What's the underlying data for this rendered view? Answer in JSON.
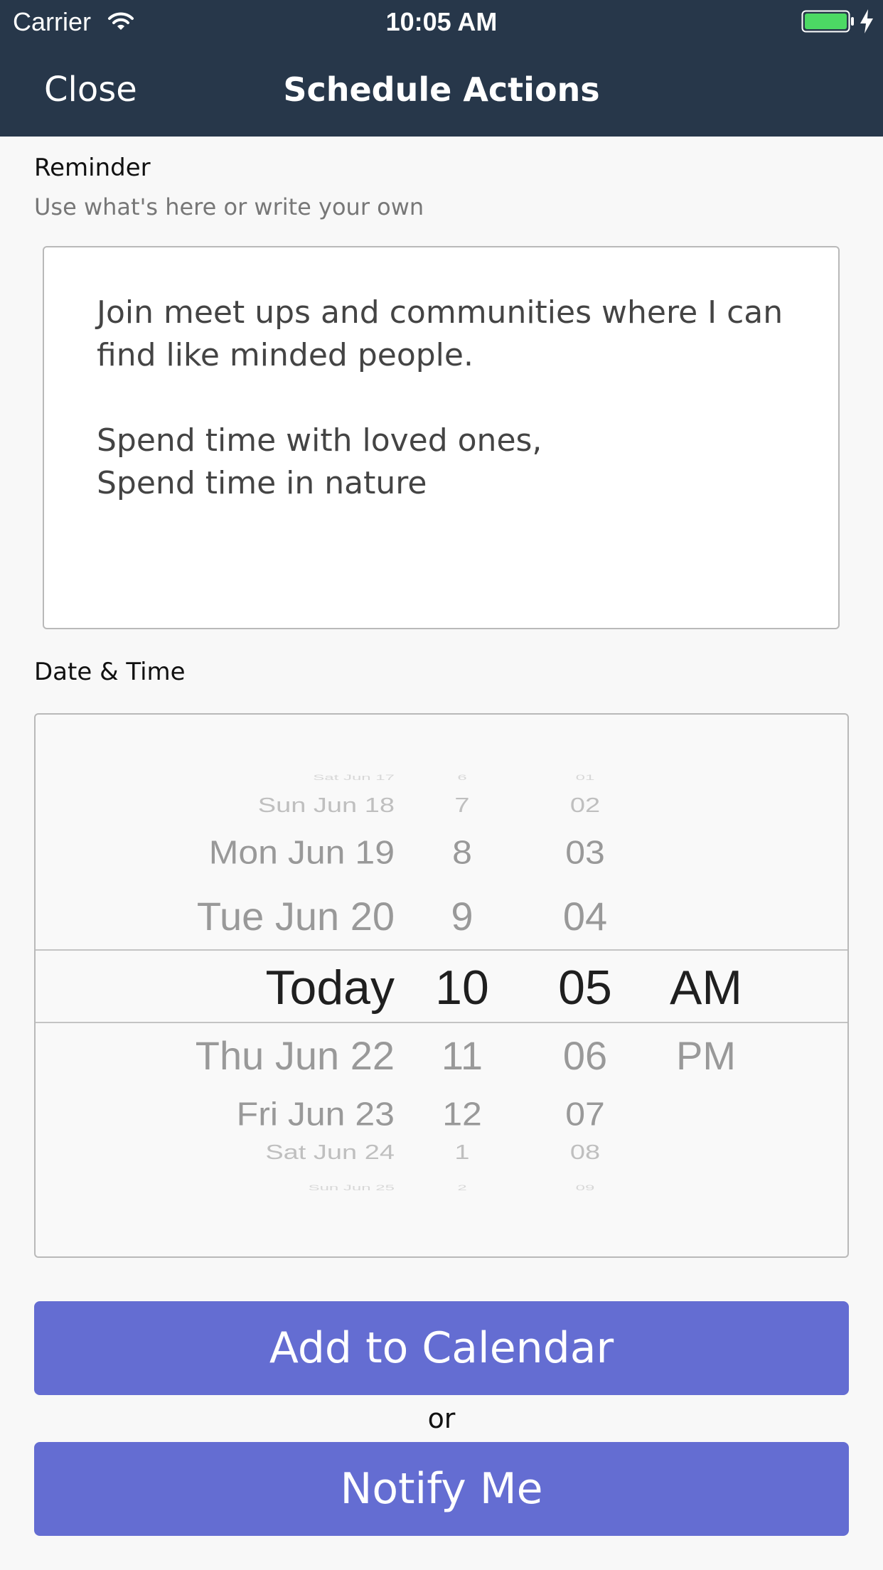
{
  "status_bar": {
    "carrier": "Carrier",
    "time": "10:05 AM",
    "battery_color": "#4cd964"
  },
  "nav": {
    "close_label": "Close",
    "title": "Schedule Actions",
    "background": "#27374a"
  },
  "reminder": {
    "label": "Reminder",
    "hint": "Use what's here or write your own",
    "text": "Join meet ups and communities where I can\nfind like minded people.\n\nSpend time with loved ones,\nSpend time in nature"
  },
  "datetime": {
    "label": "Date & Time",
    "date_col": [
      "Sat Jun 17",
      "Sun Jun 18",
      "Mon Jun 19",
      "Tue Jun 20",
      "Today",
      "Thu Jun 22",
      "Fri Jun 23",
      "Sat Jun 24",
      "Sun Jun 25"
    ],
    "hour_col": [
      "6",
      "7",
      "8",
      "9",
      "10",
      "11",
      "12",
      "1",
      "2"
    ],
    "minute_col": [
      "01",
      "02",
      "03",
      "04",
      "05",
      "06",
      "07",
      "08",
      "09"
    ],
    "ampm_col": [
      "",
      "",
      "",
      "",
      "AM",
      "PM",
      "",
      "",
      ""
    ],
    "selected_date": "Today",
    "selected_hour": "10",
    "selected_minute": "05",
    "selected_ampm": "AM"
  },
  "actions": {
    "add_to_calendar_label": "Add to Calendar",
    "or_label": "or",
    "notify_me_label": "Notify Me",
    "button_color": "#646dd2"
  }
}
